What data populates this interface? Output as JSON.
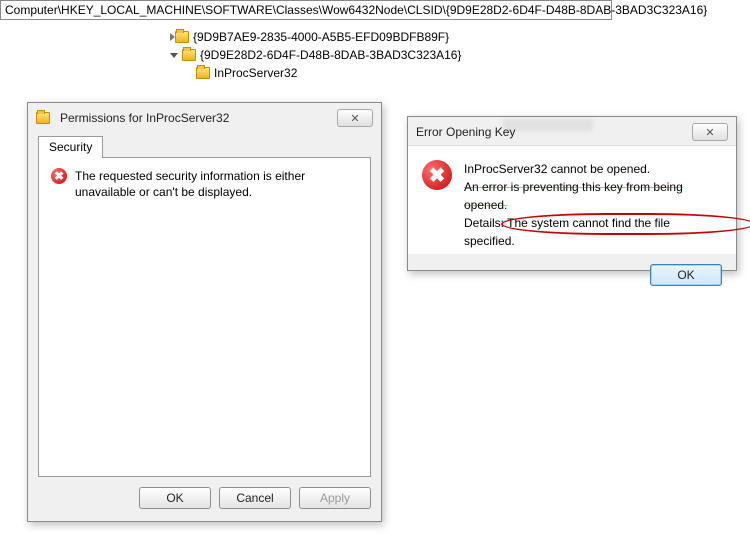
{
  "address_bar": "Computer\\HKEY_LOCAL_MACHINE\\SOFTWARE\\Classes\\Wow6432Node\\CLSID\\{9D9E28D2-6D4F-D48B-8DAB-3BAD3C323A16}",
  "tree": {
    "item0": "{9D9B7AE9-2835-4000-A5B5-EFD09BDFB89F}",
    "item1": "{9D9E28D2-6D4F-D48B-8DAB-3BAD3C323A16}",
    "item2": "InProcServer32"
  },
  "perm_dialog": {
    "title": "Permissions for InProcServer32",
    "tab": "Security",
    "message": "The requested security information is either unavailable or can't be displayed.",
    "ok": "OK",
    "cancel": "Cancel",
    "apply": "Apply"
  },
  "error_dialog": {
    "title": "Error Opening Key",
    "line1": "InProcServer32 cannot be opened.",
    "line2": "An error is preventing this key from being opened.",
    "line3a": "Details: ",
    "line3b": "The system cannot find the file specified.",
    "ok": "OK"
  }
}
